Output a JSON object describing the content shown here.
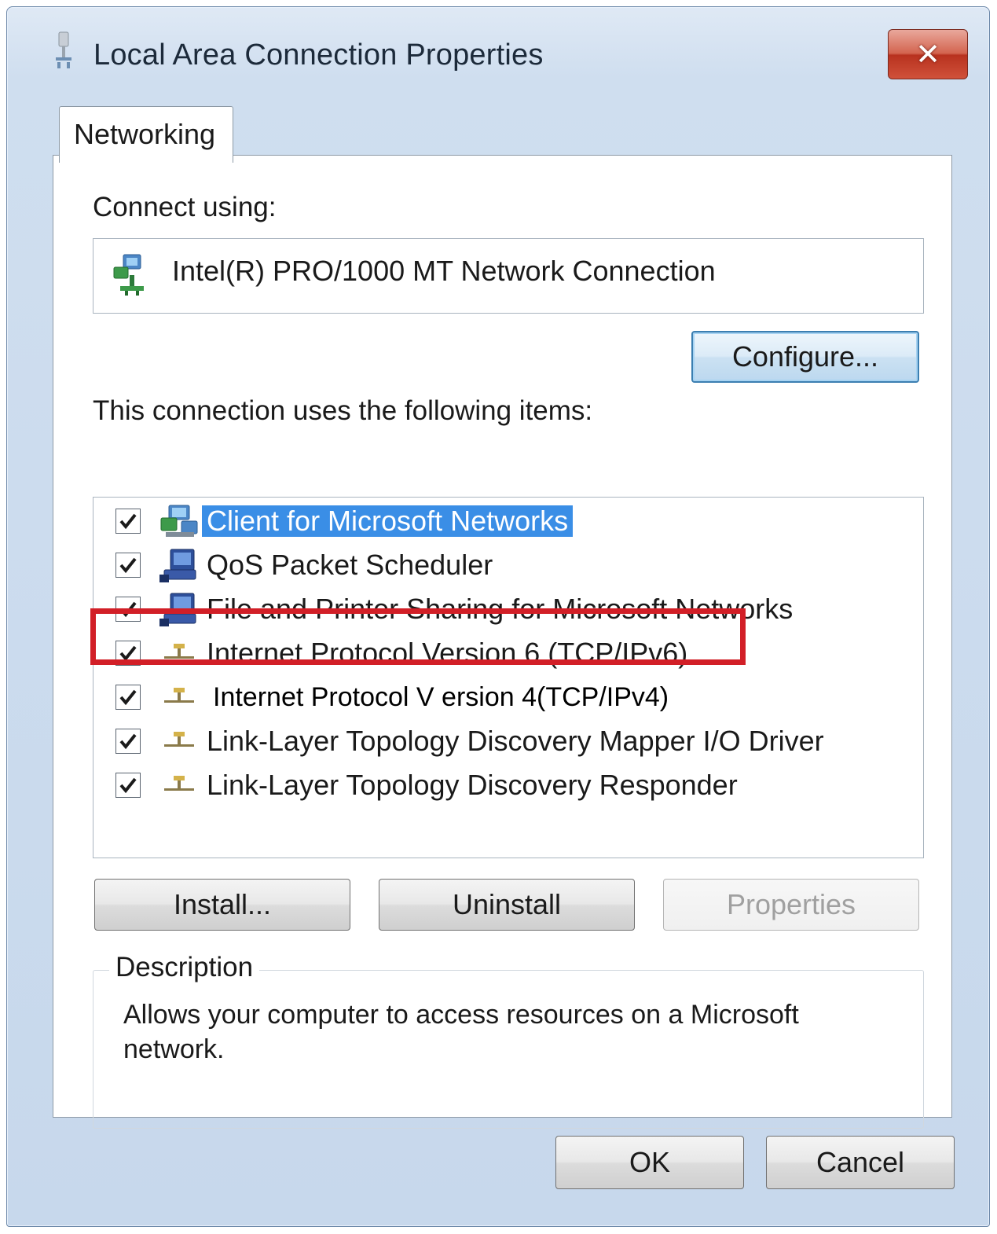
{
  "window": {
    "title": "Local Area Connection Properties",
    "close_label": "✕",
    "title_icon": "network-adapter-icon"
  },
  "tabs": [
    {
      "label": "Networking",
      "active": true
    }
  ],
  "connect_using": {
    "label": "Connect using:",
    "adapter_name": "Intel(R) PRO/1000 MT Network Connection",
    "adapter_icon": "network-adapter-icon",
    "configure_label": "Configure..."
  },
  "items_section": {
    "label": "This connection uses the following items:",
    "items": [
      {
        "label": "Client for Microsoft Networks",
        "checked": true,
        "selected": true,
        "icon": "network-client-icon"
      },
      {
        "label": "QoS Packet Scheduler",
        "checked": true,
        "selected": false,
        "icon": "network-service-icon"
      },
      {
        "label": "File and Printer Sharing for Microsoft Networks",
        "checked": true,
        "selected": false,
        "icon": "network-service-icon"
      },
      {
        "label": "Internet Protocol Version 6 (TCP/IPv6)",
        "checked": true,
        "selected": false,
        "icon": "protocol-icon"
      },
      {
        "label": "Internet Protocol V ersion 4(TCP/IPv4)",
        "checked": true,
        "selected": false,
        "icon": "protocol-icon",
        "highlighted": true
      },
      {
        "label": "Link-Layer Topology Discovery Mapper I/O Driver",
        "checked": true,
        "selected": false,
        "icon": "protocol-icon"
      },
      {
        "label": "Link-Layer Topology Discovery Responder",
        "checked": true,
        "selected": false,
        "icon": "protocol-icon"
      }
    ]
  },
  "buttons": {
    "install": "Install...",
    "uninstall": "Uninstall",
    "properties": "Properties",
    "ok": "OK",
    "cancel": "Cancel"
  },
  "description": {
    "title": "Description",
    "text": "Allows your computer to access resources on a Microsoft network."
  },
  "colors": {
    "selection": "#3a8ee6",
    "highlight_box": "#d21f27",
    "close_button": "#c9452f"
  }
}
